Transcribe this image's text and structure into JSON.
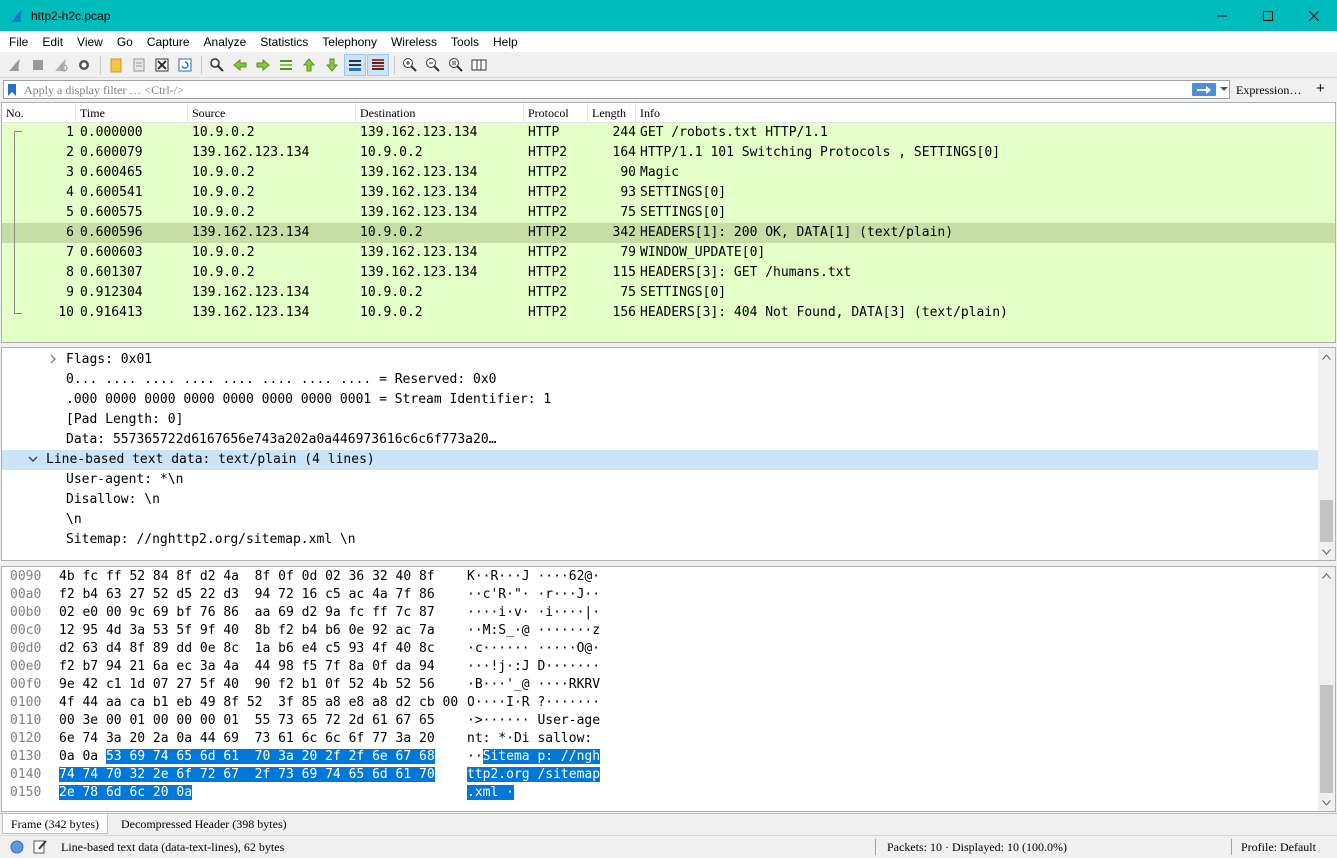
{
  "window": {
    "title": "http2-h2c.pcap",
    "controls": [
      "minimize-icon",
      "maximize-icon",
      "close-icon"
    ]
  },
  "menu": [
    "File",
    "Edit",
    "View",
    "Go",
    "Capture",
    "Analyze",
    "Statistics",
    "Telephony",
    "Wireless",
    "Tools",
    "Help"
  ],
  "filter": {
    "placeholder": "Apply a display filter … <Ctrl-/>",
    "expression_label": "Expression…",
    "plus_label": "+"
  },
  "packet_list": {
    "columns": [
      "No.",
      "Time",
      "Source",
      "Destination",
      "Protocol",
      "Length",
      "Info"
    ],
    "selected_index": 5,
    "rows": [
      {
        "no": "1",
        "time": "0.000000",
        "src": "10.9.0.2",
        "dst": "139.162.123.134",
        "proto": "HTTP",
        "len": "244",
        "info": "GET /robots.txt HTTP/1.1"
      },
      {
        "no": "2",
        "time": "0.600079",
        "src": "139.162.123.134",
        "dst": "10.9.0.2",
        "proto": "HTTP2",
        "len": "164",
        "info": "HTTP/1.1 101 Switching Protocols , SETTINGS[0]"
      },
      {
        "no": "3",
        "time": "0.600465",
        "src": "10.9.0.2",
        "dst": "139.162.123.134",
        "proto": "HTTP2",
        "len": "90",
        "info": "Magic"
      },
      {
        "no": "4",
        "time": "0.600541",
        "src": "10.9.0.2",
        "dst": "139.162.123.134",
        "proto": "HTTP2",
        "len": "93",
        "info": "SETTINGS[0]"
      },
      {
        "no": "5",
        "time": "0.600575",
        "src": "10.9.0.2",
        "dst": "139.162.123.134",
        "proto": "HTTP2",
        "len": "75",
        "info": "SETTINGS[0]"
      },
      {
        "no": "6",
        "time": "0.600596",
        "src": "139.162.123.134",
        "dst": "10.9.0.2",
        "proto": "HTTP2",
        "len": "342",
        "info": "HEADERS[1]: 200 OK, DATA[1] (text/plain)"
      },
      {
        "no": "7",
        "time": "0.600603",
        "src": "10.9.0.2",
        "dst": "139.162.123.134",
        "proto": "HTTP2",
        "len": "79",
        "info": "WINDOW_UPDATE[0]"
      },
      {
        "no": "8",
        "time": "0.601307",
        "src": "10.9.0.2",
        "dst": "139.162.123.134",
        "proto": "HTTP2",
        "len": "115",
        "info": "HEADERS[3]: GET /humans.txt"
      },
      {
        "no": "9",
        "time": "0.912304",
        "src": "139.162.123.134",
        "dst": "10.9.0.2",
        "proto": "HTTP2",
        "len": "75",
        "info": "SETTINGS[0]"
      },
      {
        "no": "10",
        "time": "0.916413",
        "src": "139.162.123.134",
        "dst": "10.9.0.2",
        "proto": "HTTP2",
        "len": "156",
        "info": "HEADERS[3]: 404 Not Found, DATA[3] (text/plain)"
      }
    ]
  },
  "details": {
    "lines": [
      {
        "text": "Flags: 0x01",
        "indent": 1,
        "arrow": "right",
        "selected": false
      },
      {
        "text": "0... .... .... .... .... .... .... .... = Reserved: 0x0",
        "indent": 2,
        "arrow": "",
        "selected": false
      },
      {
        "text": ".000 0000 0000 0000 0000 0000 0000 0001 = Stream Identifier: 1",
        "indent": 2,
        "arrow": "",
        "selected": false
      },
      {
        "text": "[Pad Length: 0]",
        "indent": 2,
        "arrow": "",
        "selected": false
      },
      {
        "text": "Data: 557365722d6167656e743a202a0a446973616c6c6f773a20…",
        "indent": 2,
        "arrow": "",
        "selected": false
      },
      {
        "text": "Line-based text data: text/plain (4 lines)",
        "indent": 0,
        "arrow": "down",
        "selected": true
      },
      {
        "text": "User-agent: *\\n",
        "indent": 2,
        "arrow": "",
        "selected": false
      },
      {
        "text": "Disallow: \\n",
        "indent": 2,
        "arrow": "",
        "selected": false
      },
      {
        "text": "\\n",
        "indent": 2,
        "arrow": "",
        "selected": false
      },
      {
        "text": "Sitemap: //nghttp2.org/sitemap.xml \\n",
        "indent": 2,
        "arrow": "",
        "selected": false
      }
    ]
  },
  "bytes": {
    "rows": [
      {
        "off": "0090",
        "hex_plain": "4b fc ff 52 84 8f d2 4a  8f 0f 0d 02 36 32 40 8f",
        "hex_hl": "",
        "ascii_plain": "K··R···J ····62@·",
        "ascii_hl": ""
      },
      {
        "off": "00a0",
        "hex_plain": "f2 b4 63 27 52 d5 22 d3  94 72 16 c5 ac 4a 7f 86",
        "hex_hl": "",
        "ascii_plain": "··c'R·\"· ·r···J··",
        "ascii_hl": ""
      },
      {
        "off": "00b0",
        "hex_plain": "02 e0 00 9c 69 bf 76 86  aa 69 d2 9a fc ff 7c 87",
        "hex_hl": "",
        "ascii_plain": "····i·v· ·i····|·",
        "ascii_hl": ""
      },
      {
        "off": "00c0",
        "hex_plain": "12 95 4d 3a 53 5f 9f 40  8b f2 b4 b6 0e 92 ac 7a",
        "hex_hl": "",
        "ascii_plain": "··M:S_·@ ·······z",
        "ascii_hl": ""
      },
      {
        "off": "00d0",
        "hex_plain": "d2 63 d4 8f 89 dd 0e 8c  1a b6 e4 c5 93 4f 40 8c",
        "hex_hl": "",
        "ascii_plain": "·c······ ·····O@·",
        "ascii_hl": ""
      },
      {
        "off": "00e0",
        "hex_plain": "f2 b7 94 21 6a ec 3a 4a  44 98 f5 7f 8a 0f da 94",
        "hex_hl": "",
        "ascii_plain": "···!j·:J D·······",
        "ascii_hl": ""
      },
      {
        "off": "00f0",
        "hex_plain": "9e 42 c1 1d 07 27 5f 40  90 f2 b1 0f 52 4b 52 56",
        "hex_hl": "",
        "ascii_plain": "·B···'_@ ····RKRV",
        "ascii_hl": ""
      },
      {
        "off": "0100",
        "hex_plain": "4f 44 aa ca b1 eb 49 8f 52  3f 85 a8 e8 a8 d2 cb 00",
        "hex_hl": "",
        "ascii_plain": "O····I·R ?·······",
        "ascii_hl": ""
      },
      {
        "off": "0110",
        "hex_plain": "00 3e 00 01 00 00 00 01  55 73 65 72 2d 61 67 65",
        "hex_hl": "",
        "ascii_plain": "·>······ User-age",
        "ascii_hl": ""
      },
      {
        "off": "0120",
        "hex_plain": "6e 74 3a 20 2a 0a 44 69  73 61 6c 6c 6f 77 3a 20",
        "hex_hl": "",
        "ascii_plain": "nt: *·Di sallow: ",
        "ascii_hl": ""
      },
      {
        "off": "0130",
        "hex_plain": "0a 0a ",
        "hex_hl": "53 69 74 65 6d 61  70 3a 20 2f 2f 6e 67 68",
        "ascii_plain": "··",
        "ascii_hl": "Sitema p: //ngh"
      },
      {
        "off": "0140",
        "hex_plain": "",
        "hex_hl": "74 74 70 32 2e 6f 72 67  2f 73 69 74 65 6d 61 70",
        "ascii_plain": "",
        "ascii_hl": "ttp2.org /sitemap"
      },
      {
        "off": "0150",
        "hex_plain": "",
        "hex_hl": "2e 78 6d 6c 20 0a",
        "ascii_plain": "",
        "ascii_hl": ".xml ·"
      }
    ]
  },
  "byte_tabs": [
    "Frame (342 bytes)",
    "Decompressed Header (398 bytes)"
  ],
  "status": {
    "field_info": "Line-based text data (data-text-lines), 62 bytes",
    "packets": "Packets: 10 · Displayed: 10 (100.0%)",
    "profile": "Profile: Default"
  }
}
